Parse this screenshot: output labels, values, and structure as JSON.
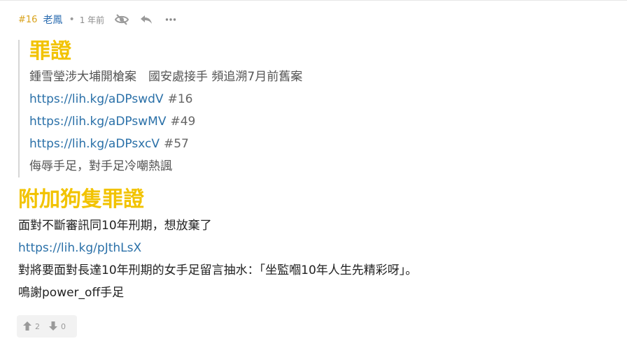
{
  "post": {
    "number": "#16",
    "author": "老鳳",
    "separator": "•",
    "time": "1 年前"
  },
  "quote": {
    "title": "罪證",
    "lines": [
      {
        "text": "鍾雪瑩涉大埔開槍案　國安處接手 頻追溯7月前舊案"
      },
      {
        "link": "https://lih.kg/aDPswdV",
        "ref": "#16"
      },
      {
        "link": "https://lih.kg/aDPswMV",
        "ref": "#49"
      },
      {
        "link": "https://lih.kg/aDPsxcV",
        "ref": "#57"
      },
      {
        "text": "侮辱手足，對手足冷嘲熱諷"
      }
    ]
  },
  "body": {
    "title": "附加狗隻罪證",
    "line1": "面對不斷審訊同10年刑期，想放棄了",
    "link": "https://lih.kg/pJthLsX",
    "line2": "對將要面對長達10年刑期的女手足留言抽水：「坐監嗰10年人生先精彩呀」。",
    "line3": "鳴謝power_off手足"
  },
  "votes": {
    "up": "2",
    "down": "0"
  },
  "colors": {
    "heading_yellow": "#f2c300",
    "link_blue": "#2a70a8",
    "post_number": "#d9a21b",
    "author_blue": "#2b6cb0"
  },
  "icons": [
    "eye-off-icon",
    "reply-icon",
    "more-icon",
    "thumb-up-icon",
    "thumb-down-icon"
  ]
}
